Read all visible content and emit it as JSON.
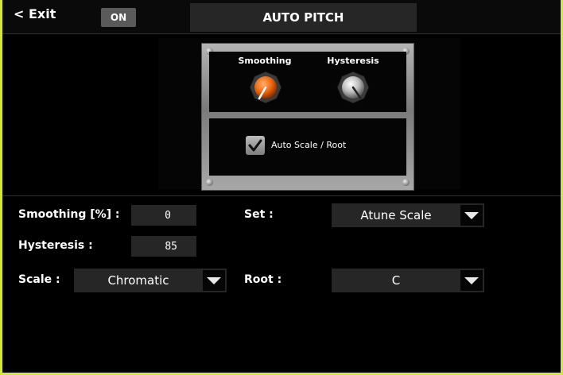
{
  "header": {
    "exit_label": "< Exit",
    "on_label": "ON",
    "title": "AUTO PITCH"
  },
  "panel": {
    "knobs": [
      {
        "label": "Smoothing",
        "color": "#f26a12",
        "icon": "knob-orange"
      },
      {
        "label": "Hysteresis",
        "color": "#c9c9c9",
        "icon": "knob-silver"
      }
    ],
    "checkbox": {
      "label": "Auto Scale / Root",
      "checked": true
    }
  },
  "params": {
    "smoothing": {
      "label": "Smoothing [%] :",
      "value": "0"
    },
    "hysteresis": {
      "label": "Hysteresis :",
      "value": "85"
    },
    "set": {
      "label": "Set :",
      "value": "Atune Scale"
    },
    "scale": {
      "label": "Scale :",
      "value": "Chromatic"
    },
    "root": {
      "label": "Root :",
      "value": "C"
    }
  },
  "colors": {
    "accent_border": "#d4e63a",
    "knob_active": "#f26a12",
    "field_bg": "#262626"
  }
}
